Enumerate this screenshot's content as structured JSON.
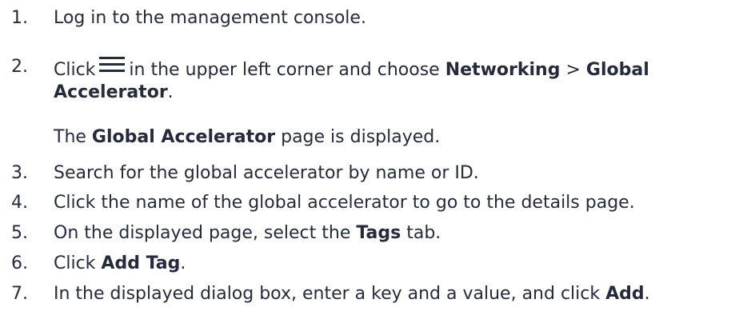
{
  "steps": [
    {
      "num": "1.",
      "text": "Log in to the management console."
    },
    {
      "num": "2.",
      "pre": "Click",
      "icon": "menu-icon",
      "mid": "in the upper left corner and choose",
      "b1": "Networking",
      "sep": ">",
      "b2": "Global",
      "b3": "Accelerator",
      "end": "."
    },
    {
      "num": "3.",
      "text": "Search for the global accelerator by name or ID."
    },
    {
      "num": "4.",
      "text": "Click the name of the global accelerator to go to the details page."
    },
    {
      "num": "5.",
      "pre": "On the displayed page, select the",
      "b1": "Tags",
      "post": "tab."
    },
    {
      "num": "6.",
      "pre": "Click",
      "b1": "Add Tag",
      "end": "."
    },
    {
      "num": "7.",
      "pre": "In the displayed dialog box, enter a key and a value, and click",
      "b1": "Add",
      "end": "."
    }
  ],
  "note": {
    "pre": "The",
    "b1": "Global Accelerator",
    "post": "page is displayed."
  }
}
